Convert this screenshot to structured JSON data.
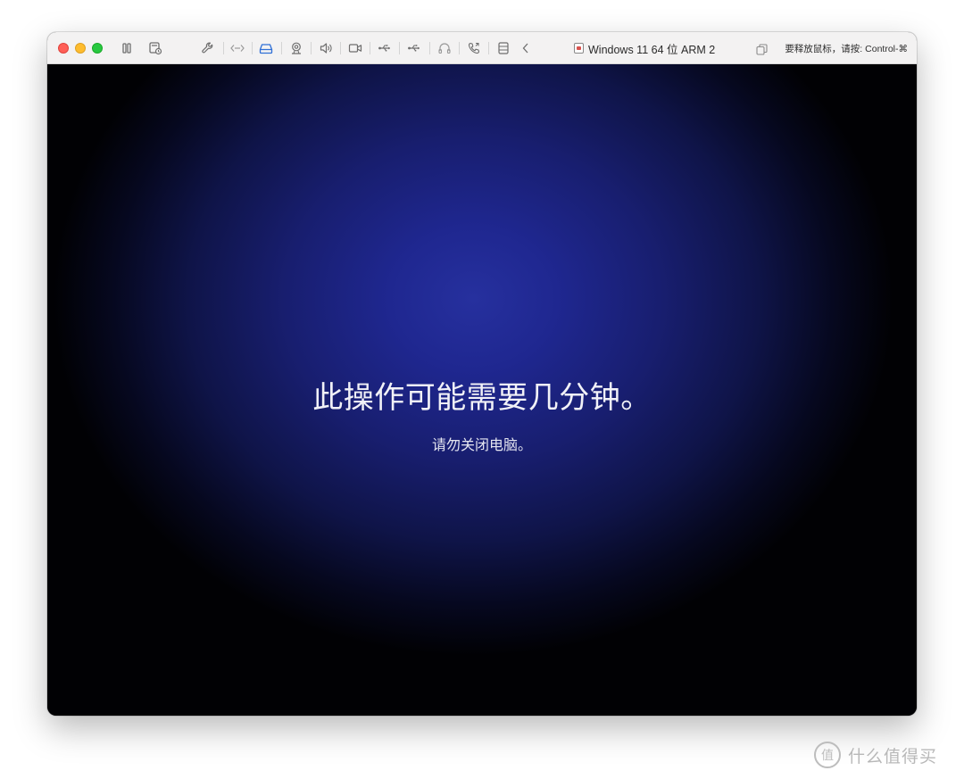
{
  "window": {
    "vm_title": "Windows 11 64 位 ARM 2",
    "release_hint": "要释放鼠标，请按: Control-⌘"
  },
  "toolbar": {
    "icons": [
      "pause-icon",
      "snapshot-icon",
      "settings-wrench-icon",
      "network-icon",
      "hard-disk-icon",
      "camera-icon",
      "sound-icon",
      "video-capture-icon",
      "usb-icon",
      "usb-icon-2",
      "headphones-icon",
      "phone-icon",
      "storage-stack-icon",
      "chevron-left-icon"
    ]
  },
  "screen": {
    "heading": "此操作可能需要几分钟。",
    "subtext": "请勿关闭电脑。"
  },
  "watermark": {
    "text": "什么值得买",
    "logo_glyph": "值"
  },
  "colors": {
    "close": "#ff5f57",
    "minimize": "#febc2e",
    "maximize": "#28c840",
    "screen_center": "#26309e",
    "screen_edge": "#010104",
    "accent_disk": "#2f6fd6"
  }
}
